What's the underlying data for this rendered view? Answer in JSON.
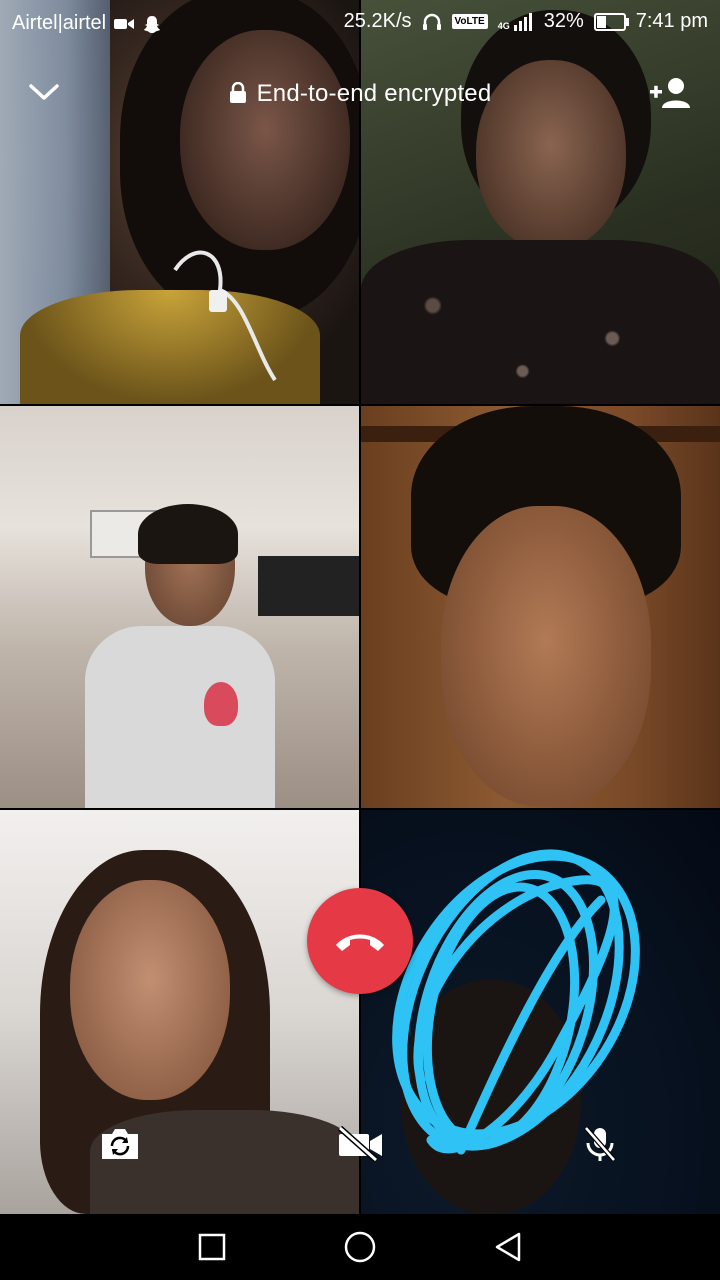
{
  "status_bar": {
    "carrier": "Airtel|airtel",
    "net_speed": "25.2K/s",
    "volte": "VoLTE",
    "network": "4G",
    "battery": "32%",
    "battery_level": 0.32,
    "time": "7:41 pm"
  },
  "call_header": {
    "encryption_text": "End-to-end encrypted"
  },
  "icons": {
    "collapse": "chevron-down-icon",
    "lock": "lock-icon",
    "add_participant": "add-user-icon",
    "end_call": "phone-hangup-icon",
    "switch_camera": "camera-switch-icon",
    "video_off": "video-off-icon",
    "mic_off": "mic-off-icon"
  },
  "colors": {
    "end_call": "#e53946",
    "scribble": "#2ec2f5"
  },
  "participants": [
    {
      "tile": 1
    },
    {
      "tile": 2
    },
    {
      "tile": 3
    },
    {
      "tile": 4
    },
    {
      "tile": 5
    },
    {
      "tile": 6
    }
  ]
}
